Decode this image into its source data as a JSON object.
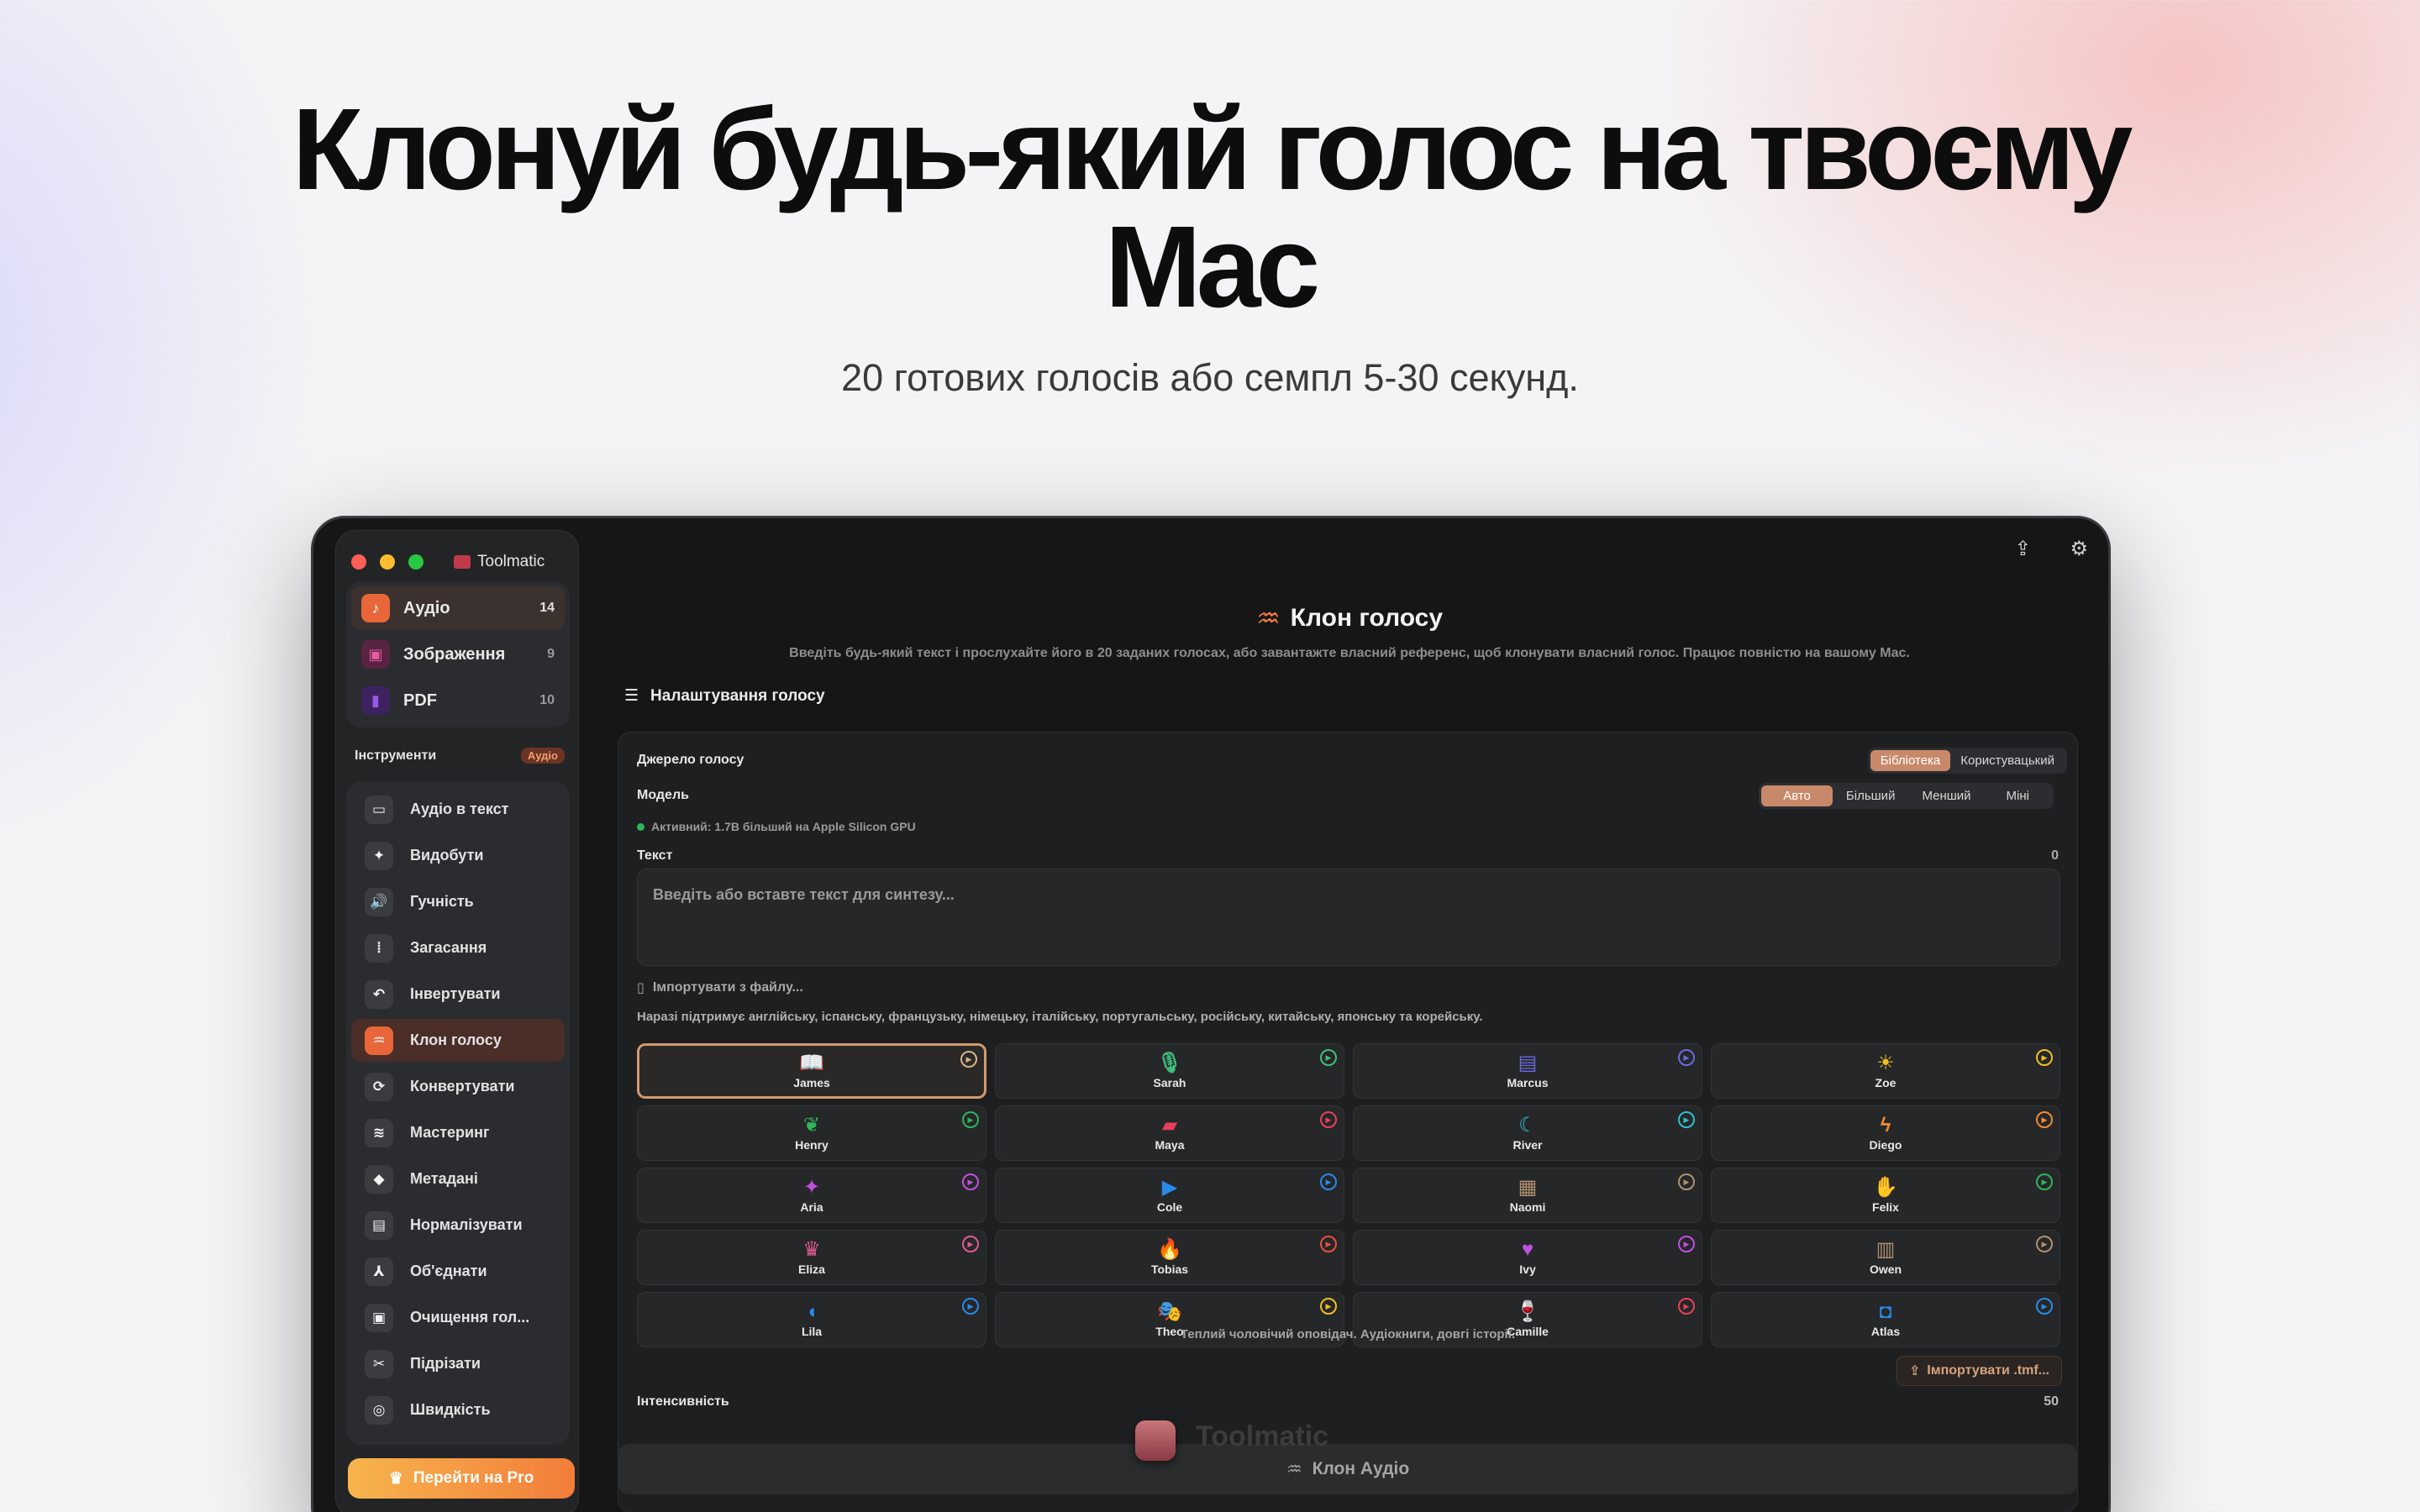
{
  "hero": {
    "title_line1": "Клонуй будь-який голос на твоєму",
    "title_line2": "Mac",
    "subtitle": "20 готових голосів або семпл 5-30 секунд."
  },
  "app": {
    "name": "Toolmatic"
  },
  "categories": [
    {
      "label": "Аудіо",
      "count": "14",
      "icon": "music-note-icon",
      "color": "#e8663a"
    },
    {
      "label": "Зображення",
      "count": "9",
      "icon": "image-icon",
      "color": "#b0307a"
    },
    {
      "label": "PDF",
      "count": "10",
      "icon": "document-icon",
      "color": "#7b2fd0"
    }
  ],
  "tools_header": {
    "label": "Інструменти",
    "badge": "Аудіо"
  },
  "tools": [
    {
      "label": "Аудіо в текст",
      "icon": "speech-bubble-icon",
      "glyph": "▭"
    },
    {
      "label": "Видобути",
      "icon": "waveform-split-icon",
      "glyph": "✦"
    },
    {
      "label": "Гучність",
      "icon": "speaker-icon",
      "glyph": "🔊"
    },
    {
      "label": "Загасання",
      "icon": "fade-wave-icon",
      "glyph": "⦙"
    },
    {
      "label": "Інвертувати",
      "icon": "undo-arrow-icon",
      "glyph": "↶"
    },
    {
      "label": "Клон голосу",
      "icon": "voice-clone-icon",
      "glyph": "♒",
      "active": true
    },
    {
      "label": "Конвертувати",
      "icon": "convert-arrows-icon",
      "glyph": "⟳"
    },
    {
      "label": "Мастеринг",
      "icon": "mastering-wave-icon",
      "glyph": "≋"
    },
    {
      "label": "Метадані",
      "icon": "tag-icon",
      "glyph": "◆"
    },
    {
      "label": "Нормалізувати",
      "icon": "level-icon",
      "glyph": "▤"
    },
    {
      "label": "Об'єднати",
      "icon": "merge-icon",
      "glyph": "⅄"
    },
    {
      "label": "Очищення гол...",
      "icon": "clean-icon",
      "glyph": "▣"
    },
    {
      "label": "Підрізати",
      "icon": "scissors-icon",
      "glyph": "✂"
    },
    {
      "label": "Швидкість",
      "icon": "speedometer-icon",
      "glyph": "◎"
    }
  ],
  "pro_button": "Перейти на Pro",
  "main": {
    "title": "Клон голосу",
    "description": "Введіть будь-який текст і прослухайте його в 20 заданих голосах, або завантажте власний референс, щоб клонувати власний голос. Працює повністю на вашому Mac.",
    "settings_title": "Налаштування голосу",
    "source_label": "Джерело голосу",
    "source_options": [
      "Бібліотека",
      "Користувацький"
    ],
    "model_label": "Модель",
    "model_options": [
      "Авто",
      "Більший",
      "Менший",
      "Міні"
    ],
    "active_model": "Активний: 1.7B більший на Apple Silicon GPU",
    "text_label": "Текст",
    "text_count": "0",
    "text_placeholder": "Введіть або вставте текст для синтезу...",
    "import_file": "Імпортувати з файлу...",
    "languages_note": "Наразі підтримує англійську, іспанську, французьку, німецьку, італійську, португальську, російську, китайську, японську та корейську.",
    "voices": [
      {
        "name": "James",
        "icon": "book-icon",
        "glyph": "📖",
        "color": "#d8b48a",
        "selected": true
      },
      {
        "name": "Sarah",
        "icon": "microphone-icon",
        "glyph": "🎙",
        "color": "#3fc07a"
      },
      {
        "name": "Marcus",
        "icon": "briefcase-icon",
        "glyph": "▤",
        "color": "#6a6ae0"
      },
      {
        "name": "Zoe",
        "icon": "sun-icon",
        "glyph": "☀",
        "color": "#f0c020"
      },
      {
        "name": "Henry",
        "icon": "leaf-icon",
        "glyph": "❦",
        "color": "#2fb55a"
      },
      {
        "name": "Maya",
        "icon": "chat-bubble-icon",
        "glyph": "▰",
        "color": "#e8405a"
      },
      {
        "name": "River",
        "icon": "moon-icon",
        "glyph": "☾",
        "color": "#30c0d0"
      },
      {
        "name": "Diego",
        "icon": "bolt-icon",
        "glyph": "ϟ",
        "color": "#f08a30"
      },
      {
        "name": "Aria",
        "icon": "sparkle-icon",
        "glyph": "✦",
        "color": "#c050e0"
      },
      {
        "name": "Cole",
        "icon": "play-box-icon",
        "glyph": "▶",
        "color": "#2a8ae8"
      },
      {
        "name": "Naomi",
        "icon": "suitcase-icon",
        "glyph": "▦",
        "color": "#b09070"
      },
      {
        "name": "Felix",
        "icon": "hand-wave-icon",
        "glyph": "✋",
        "color": "#2fb55a"
      },
      {
        "name": "Eliza",
        "icon": "crown-icon",
        "glyph": "♛",
        "color": "#e05a90"
      },
      {
        "name": "Tobias",
        "icon": "flame-icon",
        "glyph": "🔥",
        "color": "#e8503a"
      },
      {
        "name": "Ivy",
        "icon": "heart-icon",
        "glyph": "♥",
        "color": "#c050e0"
      },
      {
        "name": "Owen",
        "icon": "books-icon",
        "glyph": "▥",
        "color": "#b09070"
      },
      {
        "name": "Lila",
        "icon": "ear-icon",
        "glyph": "◖",
        "color": "#2a8ae8"
      },
      {
        "name": "Theo",
        "icon": "theater-masks-icon",
        "glyph": "🎭",
        "color": "#f0c020"
      },
      {
        "name": "Camille",
        "icon": "wine-glass-icon",
        "glyph": "🍷",
        "color": "#e8405a"
      },
      {
        "name": "Atlas",
        "icon": "cube-icon",
        "glyph": "◘",
        "color": "#2a8ae8"
      }
    ],
    "voice_description": "Теплий чоловічий оповідач. Аудіокниги, довгі історії.",
    "import_tmf": "Імпортувати .tmf...",
    "intensity_label": "Інтенсивність",
    "intensity_value": "50",
    "bottom_button": "Клон Аудіо",
    "dock_ghost_text": "Toolmatic"
  }
}
